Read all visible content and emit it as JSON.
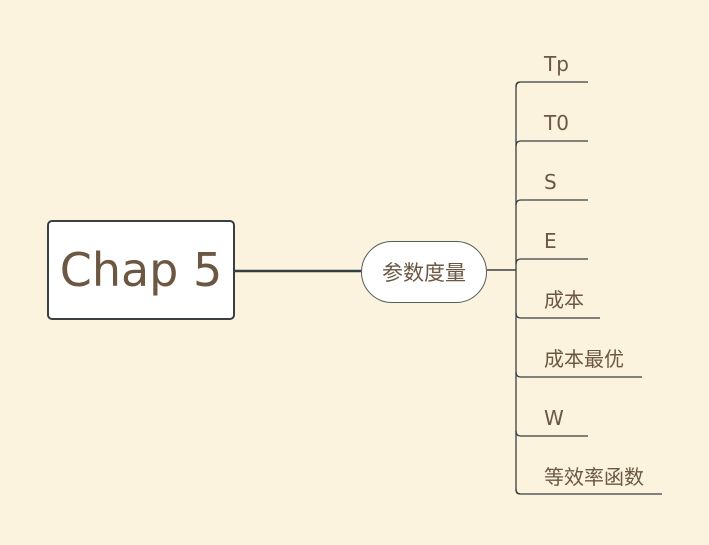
{
  "central_topic": {
    "label": "Chap 5"
  },
  "main_topic": {
    "label": "参数度量"
  },
  "subtopics": [
    {
      "label": "Tp"
    },
    {
      "label": "T0"
    },
    {
      "label": "S"
    },
    {
      "label": "E"
    },
    {
      "label": "成本"
    },
    {
      "label": "成本最优"
    },
    {
      "label": "W"
    },
    {
      "label": "等效率函数"
    }
  ],
  "colors": {
    "background": "#fbf3dd",
    "text": "#6b5742",
    "line": "#3a3f44"
  }
}
